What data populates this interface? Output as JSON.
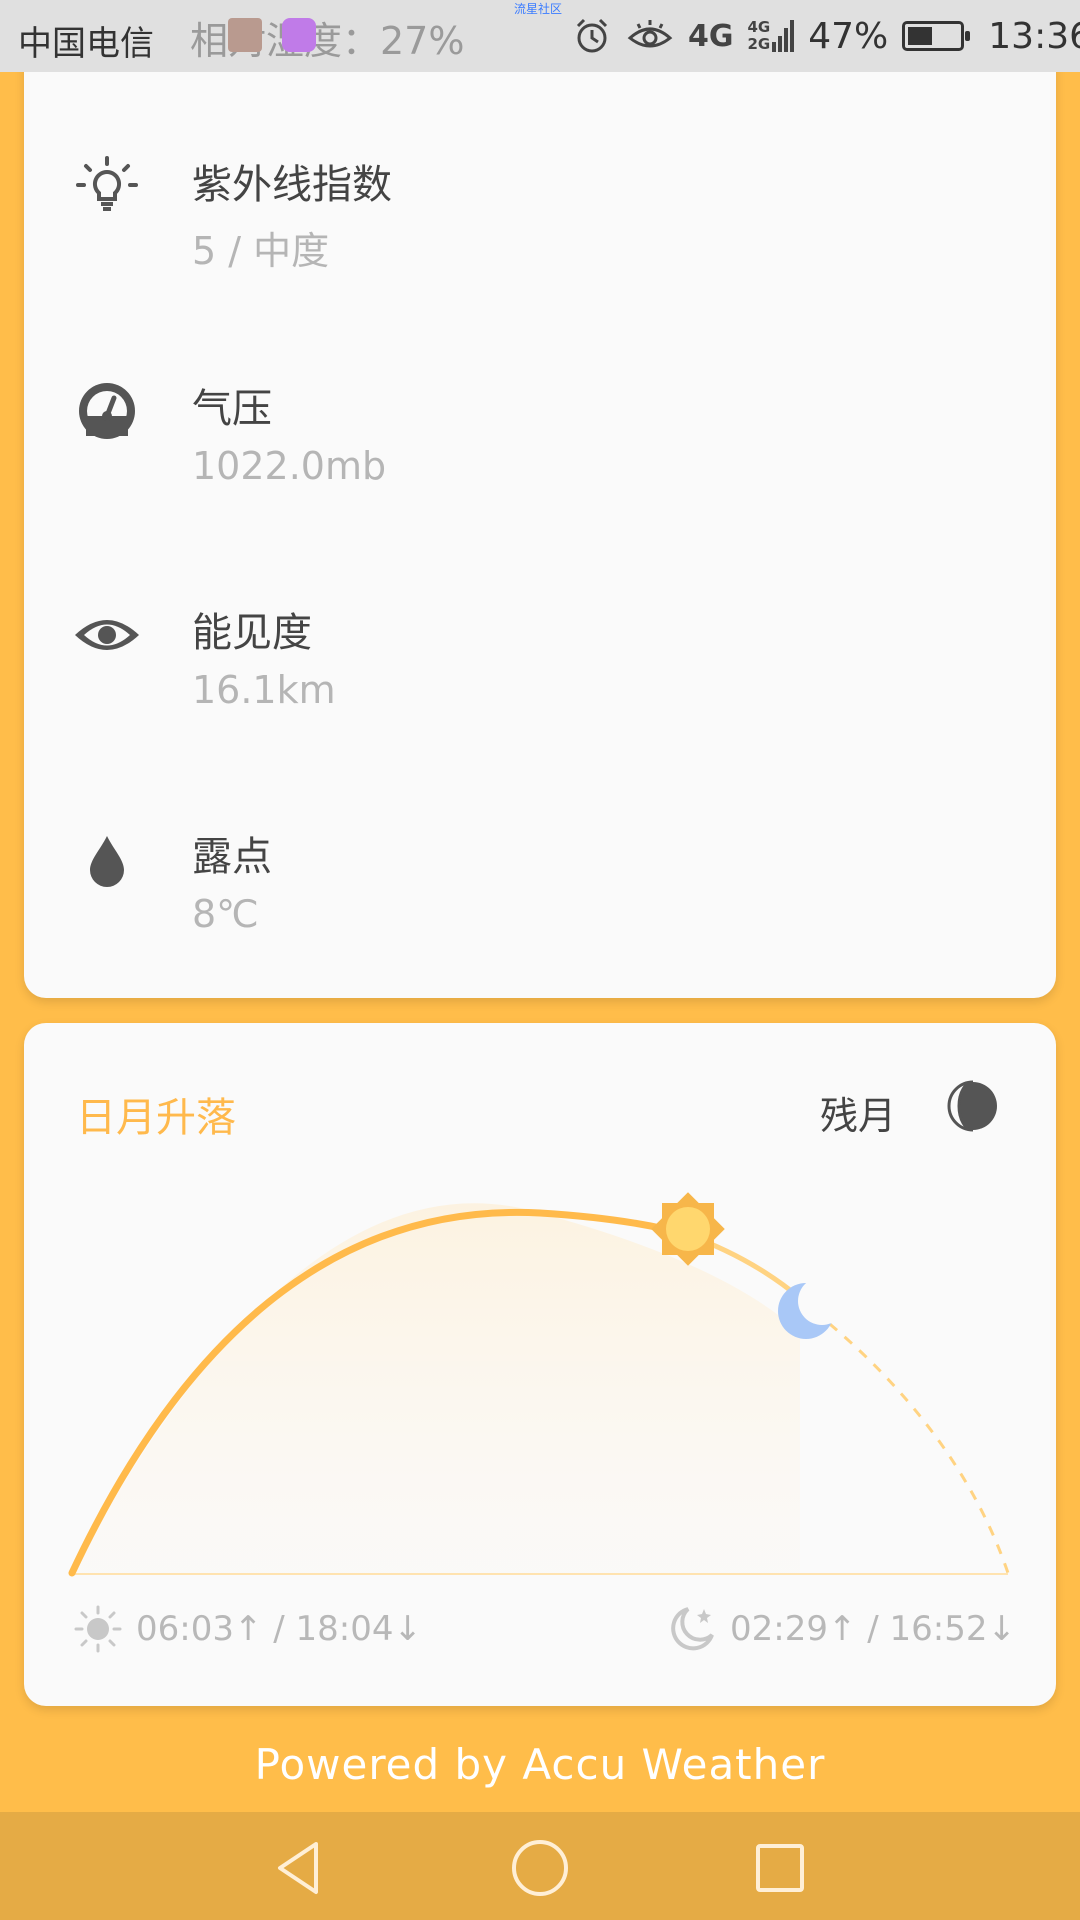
{
  "status_bar": {
    "carrier": "中国电信",
    "ghost_text": "相对湿度：27%",
    "tiny_label": "流星社区",
    "network": "4G",
    "network2_top": "4G",
    "network2_bottom": "2G",
    "battery": "47%",
    "time": "13:36"
  },
  "details": [
    {
      "icon": "uv-bulb-icon",
      "title": "紫外线指数",
      "value": "5 / 中度"
    },
    {
      "icon": "pressure-gauge-icon",
      "title": "气压",
      "value": "1022.0mb"
    },
    {
      "icon": "eye-icon",
      "title": "能见度",
      "value": "16.1km"
    },
    {
      "icon": "droplet-icon",
      "title": "露点",
      "value": "8℃"
    }
  ],
  "sun_moon": {
    "title": "日月升落",
    "moon_phase": "残月",
    "sun_times": "06:03↑ / 18:04↓",
    "moon_times": "02:29↑ / 16:52↓",
    "colors": {
      "arc": "#FFBA4B",
      "moon": "#A9C8F7",
      "sun": "#FFD76E"
    }
  },
  "footer": {
    "powered": "Powered by Accu Weather"
  },
  "nav": {
    "back": "back-icon",
    "home": "home-icon",
    "recents": "recents-icon"
  },
  "theme": {
    "background": "#FFBD4A",
    "card": "#FAFAFA"
  }
}
